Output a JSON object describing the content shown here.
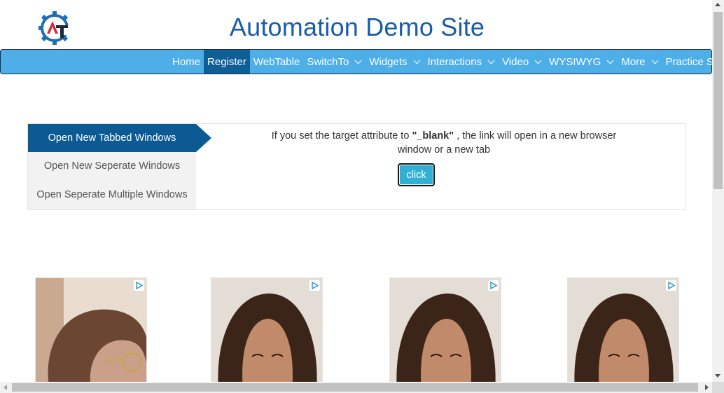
{
  "header": {
    "title": "Automation Demo Site",
    "logo_icon": "gear-logo-icon",
    "logo_letters": "AT"
  },
  "nav": {
    "items": [
      {
        "label": "Home",
        "dropdown": false,
        "active": false
      },
      {
        "label": "Register",
        "dropdown": false,
        "active": true
      },
      {
        "label": "WebTable",
        "dropdown": false,
        "active": false
      },
      {
        "label": "SwitchTo",
        "dropdown": true,
        "active": false
      },
      {
        "label": "Widgets",
        "dropdown": true,
        "active": false
      },
      {
        "label": "Interactions",
        "dropdown": true,
        "active": false
      },
      {
        "label": "Video",
        "dropdown": true,
        "active": false
      },
      {
        "label": "WYSIWYG",
        "dropdown": true,
        "active": false
      },
      {
        "label": "More",
        "dropdown": true,
        "active": false
      },
      {
        "label": "Practice Site",
        "dropdown": false,
        "active": false
      }
    ]
  },
  "tabs": {
    "items": [
      {
        "label": "Open New Tabbed Windows",
        "active": true
      },
      {
        "label": "Open New Seperate Windows",
        "active": false
      },
      {
        "label": "Open Seperate Multiple Windows",
        "active": false
      }
    ],
    "content": {
      "text_before": "If you set the target attribute to ",
      "text_bold": "\"_blank\"",
      "text_after": " , the link will open in a new browser window or a new tab",
      "button_label": "click"
    }
  },
  "ads": {
    "badge_icon": "adchoices-icon",
    "count": 4
  },
  "colors": {
    "title": "#1a5ca8",
    "nav_bg": "#4eaee8",
    "nav_active": "#0f5f97",
    "tab_active": "#0c5a94",
    "button": "#31b0d5"
  }
}
